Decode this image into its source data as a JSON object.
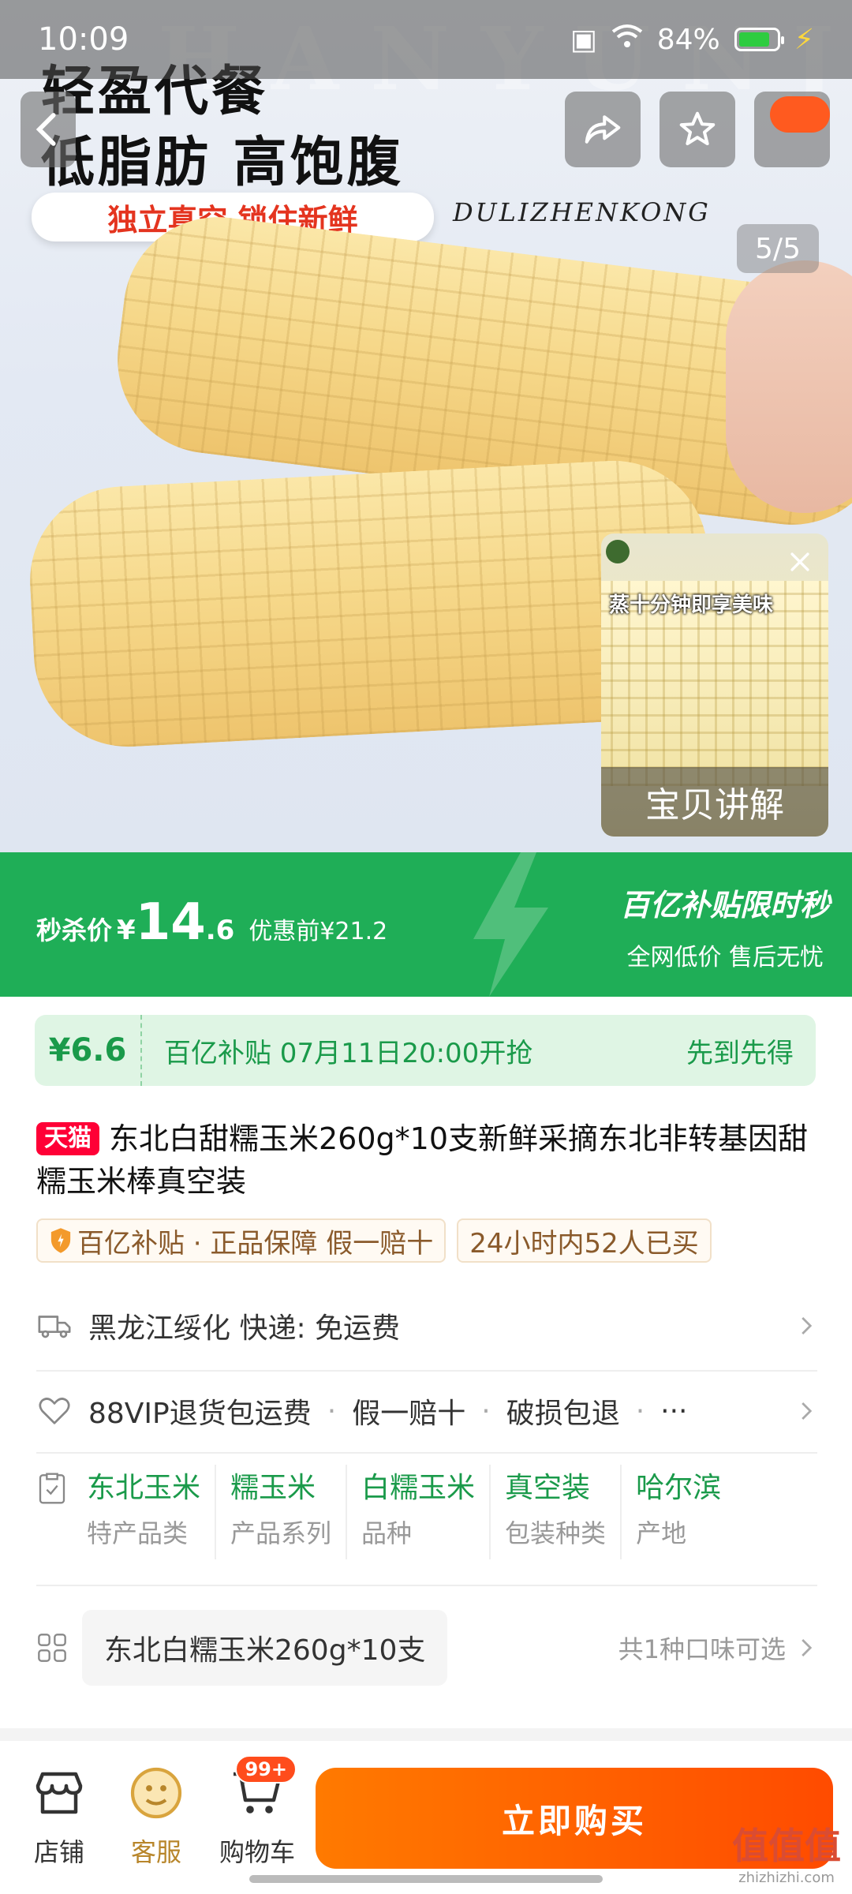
{
  "status_bar": {
    "time": "10:09",
    "battery": "84%",
    "battery_level": 0.84
  },
  "hero": {
    "watermark": "HANYUNJI",
    "headline_1": "轻盈代餐",
    "headline_2": "低脂肪  高饱腹",
    "tag_cn": "独立真空  锁住新鲜",
    "tag_latin": "DULIZHENKONG",
    "page_indicator": "5/5",
    "video": {
      "subtitle": "蒸十分钟即享美味",
      "caption": "宝贝讲解"
    },
    "icons": {
      "back": "chevron-left-icon",
      "share": "share-icon",
      "favorite": "star-icon",
      "more": "more-icon"
    }
  },
  "promo": {
    "label": "秒杀价",
    "currency": "¥",
    "price_int": "14",
    "price_dec": ".6",
    "original": "优惠前¥21.2",
    "slogan": "百亿补贴限时秒",
    "sub_slogan": "全网低价 售后无忧"
  },
  "subsidy": {
    "price": "¥6.6",
    "info": "百亿补贴 07月11日20:00开抢",
    "tag": "先到先得"
  },
  "product": {
    "badge": "天猫",
    "title": "东北白甜糯玉米260g*10支新鲜采摘东北非转基因甜糯玉米棒真空装",
    "guarantee": "百亿补贴 · 正品保障 假一赔十",
    "sales": "24小时内52人已买"
  },
  "shipping": {
    "text": "黑龙江绥化  快递: 免运费"
  },
  "service": {
    "items": [
      "88VIP退货包运费",
      "·",
      "假一赔十",
      "·",
      "破损包退",
      "·",
      "···"
    ]
  },
  "attributes": [
    {
      "value": "东北玉米",
      "key": "特产品类"
    },
    {
      "value": "糯玉米",
      "key": "产品系列"
    },
    {
      "value": "白糯玉米",
      "key": "品种"
    },
    {
      "value": "真空装",
      "key": "包装种类"
    },
    {
      "value": "哈尔滨",
      "key": "产地"
    }
  ],
  "variant": {
    "selected": "东北白糯玉米260g*10支",
    "count": "共1种口味可选"
  },
  "bottom_bar": {
    "shop": "店铺",
    "service": "客服",
    "cart": "购物车",
    "cart_badge": "99+",
    "buy": "立即购买"
  },
  "site_mark": {
    "big": "值值值",
    "small": "zhizhizhi.com"
  },
  "colors": {
    "accent_green": "#1fae57",
    "buy_orange": "#ff5a00",
    "tmall_red": "#ff0036"
  }
}
